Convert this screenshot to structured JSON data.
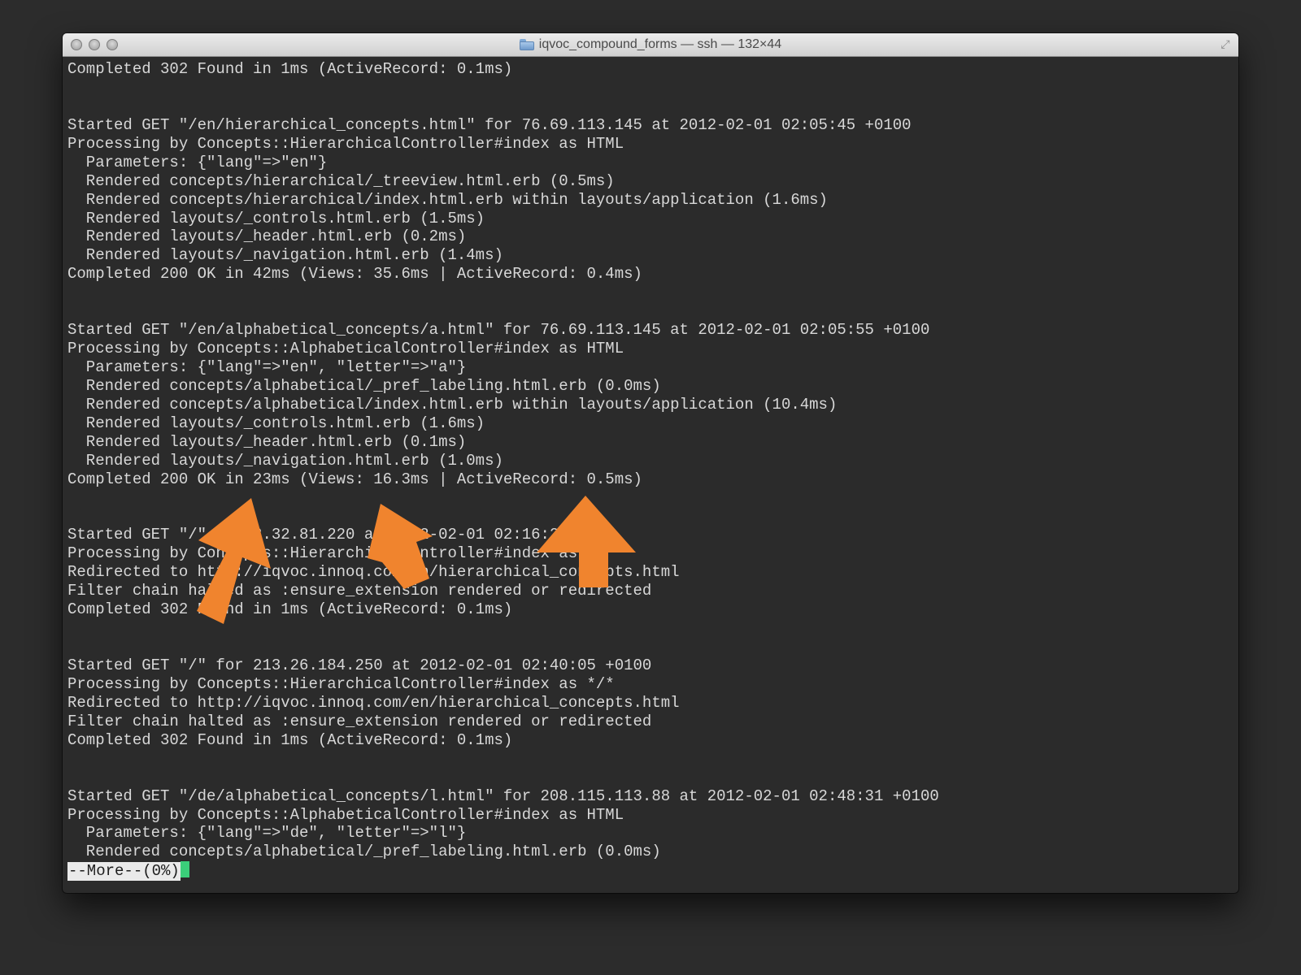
{
  "window": {
    "title": "iqvoc_compound_forms — ssh — 132×44"
  },
  "terminal": {
    "lines": [
      "Completed 302 Found in 1ms (ActiveRecord: 0.1ms)",
      "",
      "",
      "Started GET \"/en/hierarchical_concepts.html\" for 76.69.113.145 at 2012-02-01 02:05:45 +0100",
      "Processing by Concepts::HierarchicalController#index as HTML",
      "  Parameters: {\"lang\"=>\"en\"}",
      "  Rendered concepts/hierarchical/_treeview.html.erb (0.5ms)",
      "  Rendered concepts/hierarchical/index.html.erb within layouts/application (1.6ms)",
      "  Rendered layouts/_controls.html.erb (1.5ms)",
      "  Rendered layouts/_header.html.erb (0.2ms)",
      "  Rendered layouts/_navigation.html.erb (1.4ms)",
      "Completed 200 OK in 42ms (Views: 35.6ms | ActiveRecord: 0.4ms)",
      "",
      "",
      "Started GET \"/en/alphabetical_concepts/a.html\" for 76.69.113.145 at 2012-02-01 02:05:55 +0100",
      "Processing by Concepts::AlphabeticalController#index as HTML",
      "  Parameters: {\"lang\"=>\"en\", \"letter\"=>\"a\"}",
      "  Rendered concepts/alphabetical/_pref_labeling.html.erb (0.0ms)",
      "  Rendered concepts/alphabetical/index.html.erb within layouts/application (10.4ms)",
      "  Rendered layouts/_controls.html.erb (1.6ms)",
      "  Rendered layouts/_header.html.erb (0.1ms)",
      "  Rendered layouts/_navigation.html.erb (1.0ms)",
      "Completed 200 OK in 23ms (Views: 16.3ms | ActiveRecord: 0.5ms)",
      "",
      "",
      "Started GET \"/\" for 2.32.81.220 at 2012-02-01 02:16:2",
      "Processing by Concepts::HierarchicalController#index as */*",
      "Redirected to http://iqvoc.innoq.com/en/hierarchical_concepts.html",
      "Filter chain halted as :ensure_extension rendered or redirected",
      "Completed 302 Found in 1ms (ActiveRecord: 0.1ms)",
      "",
      "",
      "Started GET \"/\" for 213.26.184.250 at 2012-02-01 02:40:05 +0100",
      "Processing by Concepts::HierarchicalController#index as */*",
      "Redirected to http://iqvoc.innoq.com/en/hierarchical_concepts.html",
      "Filter chain halted as :ensure_extension rendered or redirected",
      "Completed 302 Found in 1ms (ActiveRecord: 0.1ms)",
      "",
      "",
      "Started GET \"/de/alphabetical_concepts/l.html\" for 208.115.113.88 at 2012-02-01 02:48:31 +0100",
      "Processing by Concepts::AlphabeticalController#index as HTML",
      "  Parameters: {\"lang\"=>\"de\", \"letter\"=>\"l\"}",
      "  Rendered concepts/alphabetical/_pref_labeling.html.erb (0.0ms)"
    ],
    "pager_prompt": "--More--(0%)"
  },
  "annotations": {
    "arrow_color": "#f0842e",
    "arrow_count": 3
  }
}
